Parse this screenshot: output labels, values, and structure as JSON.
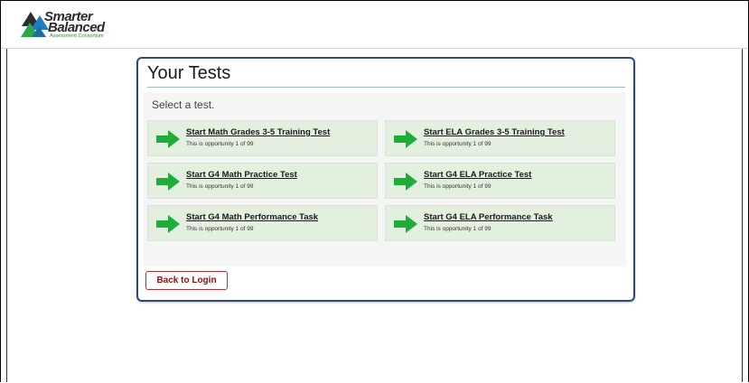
{
  "header": {
    "logo": {
      "line1": "Smarter",
      "line2": "Balanced",
      "line3": "Assessment Consortium"
    }
  },
  "panel": {
    "title": "Your Tests",
    "instruction": "Select a test.",
    "tests": [
      {
        "name": "Start Math Grades 3-5 Training Test",
        "opportunity": "This is opportunity 1 of 99"
      },
      {
        "name": "Start ELA Grades 3-5 Training Test",
        "opportunity": "This is opportunity 1 of 99"
      },
      {
        "name": "Start G4 Math Practice Test",
        "opportunity": "This is opportunity 1 of 99"
      },
      {
        "name": "Start G4 ELA Practice Test",
        "opportunity": "This is opportunity 1 of 99"
      },
      {
        "name": "Start G4 Math Performance Task",
        "opportunity": "This is opportunity 1 of 99"
      },
      {
        "name": "Start G4 ELA Performance Task",
        "opportunity": "This is opportunity 1 of 99"
      }
    ],
    "back_button": "Back to Login"
  },
  "colors": {
    "panel_border": "#2e4a73",
    "tile_bg": "#e3f0e0",
    "arrow": "#1fad3a",
    "back_button_border": "#b03030"
  },
  "icons": {
    "test_arrow": "right-arrow-icon",
    "logo_mark": "triangle-logo-icon"
  }
}
